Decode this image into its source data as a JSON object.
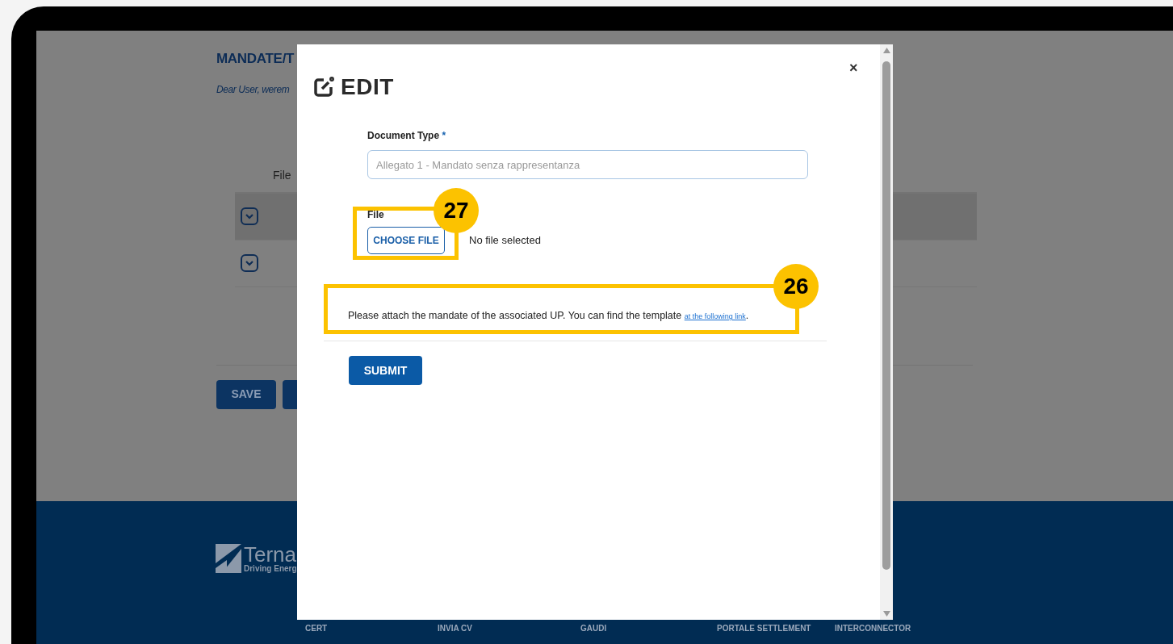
{
  "page": {
    "title": "MANDATE/T",
    "intro": "Dear User, werem",
    "table": {
      "columns": [
        "File"
      ],
      "rows": [
        {
          "expanded": false,
          "shaded": true
        },
        {
          "expanded": false,
          "shaded": false
        }
      ]
    },
    "buttons": [
      "SAVE"
    ]
  },
  "footer": {
    "logo_name": "Terna",
    "logo_tagline": "Driving Energ",
    "links": [
      "CERT",
      "INVIA CV",
      "GAUDI",
      "PORTALE SETTLEMENT",
      "INTERCONNECTOR"
    ]
  },
  "modal": {
    "title": "EDIT",
    "close": "×",
    "document_type": {
      "label": "Document Type",
      "required_mark": "*",
      "placeholder": "Allegato 1 - Mandato senza rappresentanza"
    },
    "file": {
      "label": "File",
      "button": "CHOOSE FILE",
      "status": "No file selected"
    },
    "hint": "Please attach the mandate of the associated UP. You can find the template",
    "hint_link": "at the following link",
    "hint_end": ".",
    "submit": "SUBMIT"
  },
  "annotations": [
    {
      "number": "27"
    },
    {
      "number": "26"
    }
  ]
}
